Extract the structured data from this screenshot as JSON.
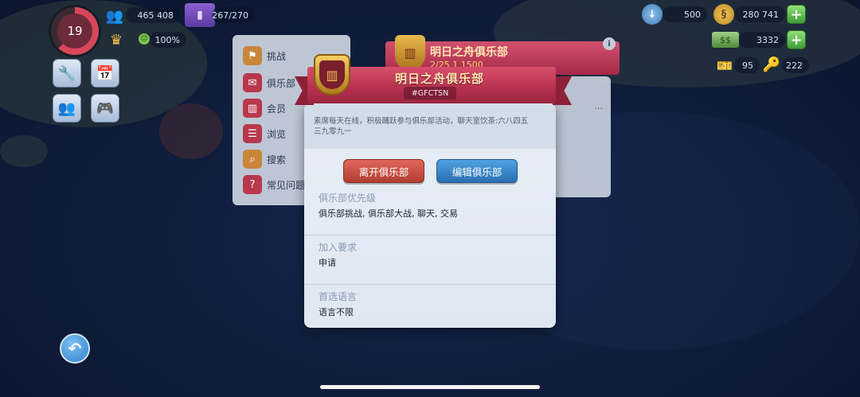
{
  "hud": {
    "level": "19",
    "population": "465 408",
    "storage": "267/270",
    "happiness": "100%",
    "simoleons_blue": "500",
    "simoleons": "280 741",
    "cash": "3332",
    "tickets": "95",
    "keys": "222",
    "icons": {
      "population": "people-icon",
      "storage": "storage-icon",
      "crown": "crown-icon",
      "happiness": "smiley-icon",
      "blue_coin": "blue-coin-icon",
      "simoleon": "simoleon-icon",
      "cash": "cash-icon",
      "ticket": "ticket-icon",
      "key": "key-icon"
    }
  },
  "side_menu": {
    "items": [
      {
        "label": "挑战",
        "icon": "challenge-icon"
      },
      {
        "label": "俱乐部",
        "icon": "club-chat-icon"
      },
      {
        "label": "会员",
        "icon": "members-icon"
      },
      {
        "label": "浏览",
        "icon": "browse-icon"
      },
      {
        "label": "搜索",
        "icon": "search-icon"
      },
      {
        "label": "常见问题",
        "icon": "faq-icon"
      }
    ]
  },
  "background_card": {
    "title": "明日之舟俱乐部",
    "stats": "2/25    1    1500",
    "ellipsis": "···"
  },
  "dialog": {
    "title": "明日之舟俱乐部",
    "tag": "#GFCTSN",
    "description_line1": "素席每天在线，积极踊跃参与俱乐部活动，聊天室饮茶:六八四五",
    "description_line2": "三九零九一",
    "leave_button": "离开俱乐部",
    "edit_button": "编辑俱乐部",
    "sections": [
      {
        "title": "俱乐部优先级",
        "value": "俱乐部挑战, 俱乐部大战, 聊天, 交易"
      },
      {
        "title": "加入要求",
        "value": "申请"
      },
      {
        "title": "首选语言",
        "value": "语言不限"
      }
    ]
  },
  "colors": {
    "ribbon": "#b5304e",
    "title_text": "#ffe8b3",
    "leave_button": "#c24a3c",
    "edit_button": "#3a88cc",
    "ocean": "#14274f"
  }
}
